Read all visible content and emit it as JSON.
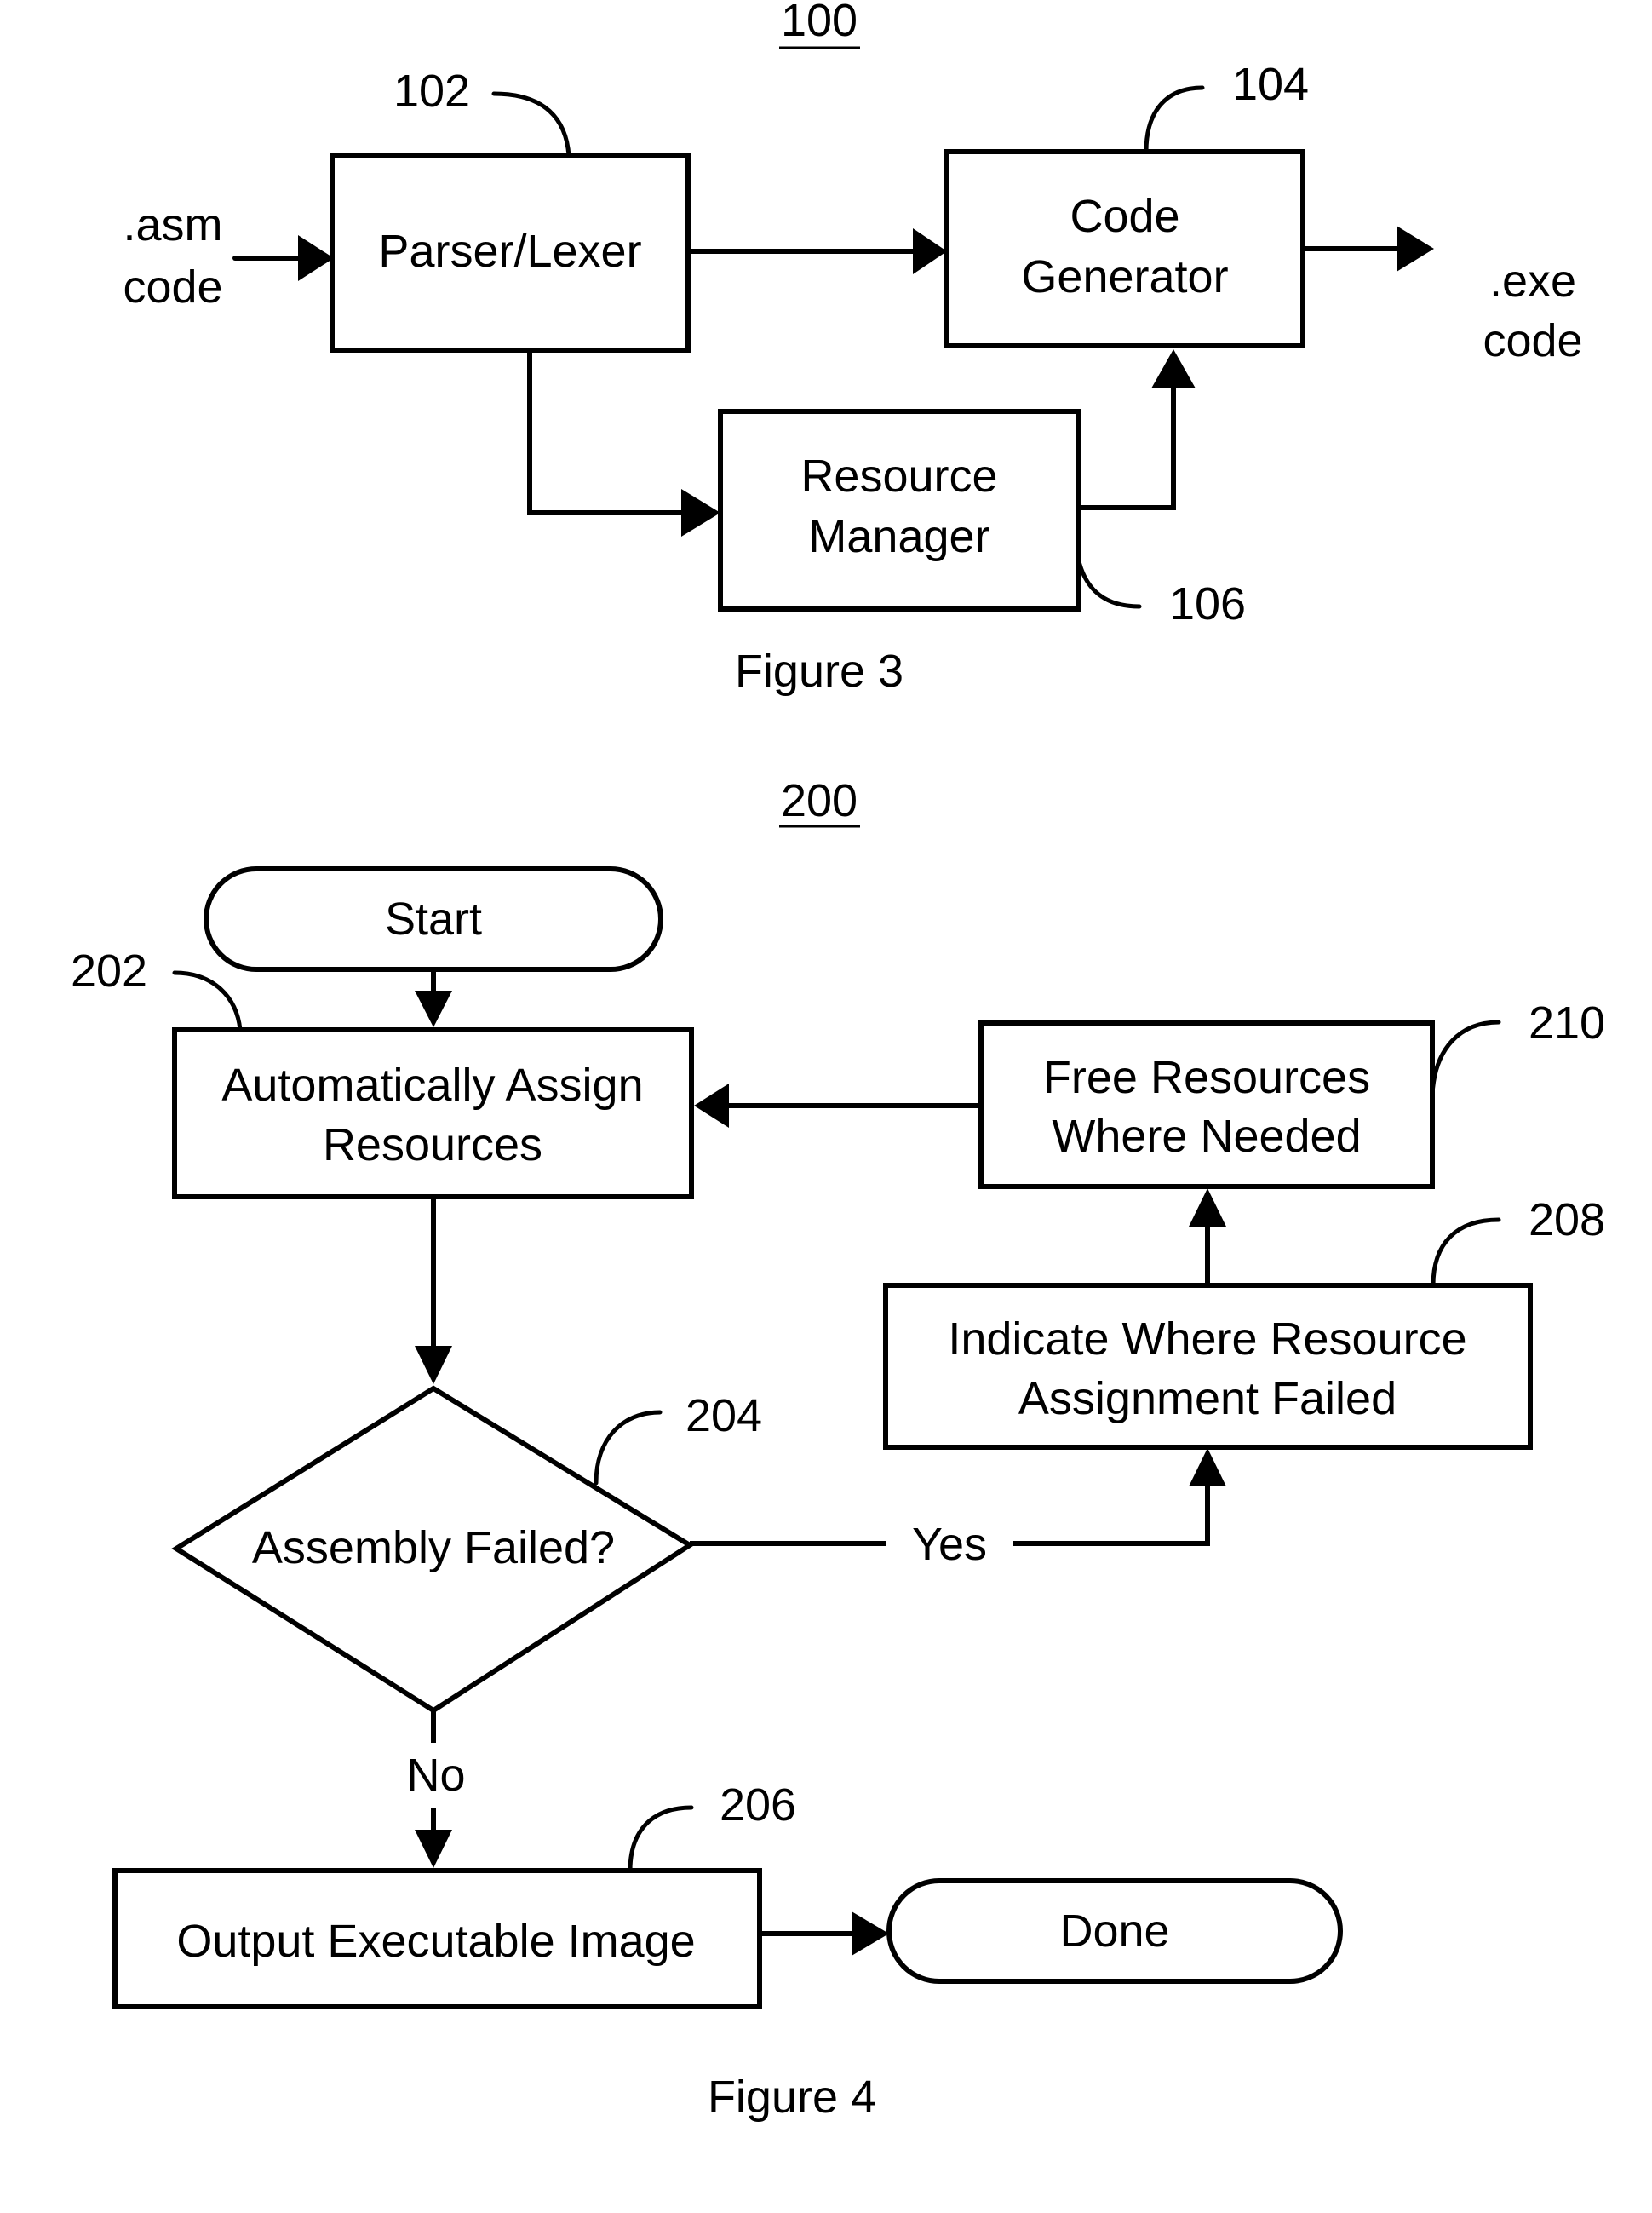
{
  "figure3": {
    "ref_number": "100",
    "caption": "Figure 3",
    "input_label": [
      ".asm",
      "code"
    ],
    "output_label": [
      ".exe",
      "code"
    ],
    "nodes": {
      "parser": {
        "ref": "102",
        "lines": [
          "Parser/Lexer"
        ]
      },
      "codegen": {
        "ref": "104",
        "lines": [
          "Code",
          "Generator"
        ]
      },
      "resource_manager": {
        "ref": "106",
        "lines": [
          "Resource",
          "Manager"
        ]
      }
    }
  },
  "figure4": {
    "ref_number": "200",
    "caption": "Figure 4",
    "nodes": {
      "start": {
        "lines": [
          "Start"
        ]
      },
      "assign": {
        "ref": "202",
        "lines": [
          "Automatically Assign",
          "Resources"
        ]
      },
      "decision": {
        "ref": "204",
        "lines": [
          "Assembly Failed?"
        ]
      },
      "output": {
        "ref": "206",
        "lines": [
          "Output Executable Image"
        ]
      },
      "indicate": {
        "ref": "208",
        "lines": [
          "Indicate Where Resource",
          "Assignment Failed"
        ]
      },
      "free": {
        "ref": "210",
        "lines": [
          "Free Resources",
          "Where Needed"
        ]
      },
      "done": {
        "lines": [
          "Done"
        ]
      }
    },
    "edge_labels": {
      "yes": "Yes",
      "no": "No"
    }
  }
}
